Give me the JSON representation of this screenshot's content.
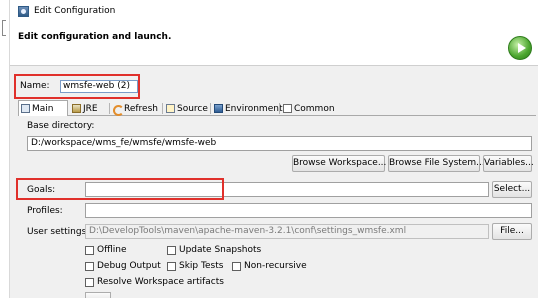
{
  "window": {
    "title": "Edit Configuration"
  },
  "header": {
    "text": "Edit configuration and launch."
  },
  "name": {
    "label": "Name:",
    "value": "wmsfe-web (2)"
  },
  "tabs": [
    {
      "label": "Main",
      "icon": "main-tab-icon"
    },
    {
      "label": "JRE",
      "icon": "jre-icon"
    },
    {
      "label": "Refresh",
      "icon": "refresh-icon"
    },
    {
      "label": "Source",
      "icon": "source-icon"
    },
    {
      "label": "Environment",
      "icon": "environment-icon"
    },
    {
      "label": "Common",
      "icon": "common-icon"
    }
  ],
  "main": {
    "base_dir_label": "Base directory:",
    "base_dir_value": "D:/workspace/wms_fe/wmsfe/wmsfe-web",
    "browse_workspace": "Browse Workspace...",
    "browse_fs": "Browse File System...",
    "variables": "Variables...",
    "goals_label": "Goals:",
    "goals_value": "",
    "select": "Select...",
    "profiles_label": "Profiles:",
    "profiles_value": "",
    "user_settings_label": "User settings:",
    "user_settings_value": "D:\\DevelopTools\\maven\\apache-maven-3.2.1\\conf\\settings_wmsfe.xml",
    "file_button": "File...",
    "checkboxes": {
      "offline": "Offline",
      "update_snapshots": "Update Snapshots",
      "debug_output": "Debug Output",
      "skip_tests": "Skip Tests",
      "non_recursive": "Non-recursive",
      "resolve_workspace": "Resolve Workspace artifacts"
    }
  },
  "colors": {
    "highlight": "#e0302b",
    "run_green": "#4aa52d"
  }
}
